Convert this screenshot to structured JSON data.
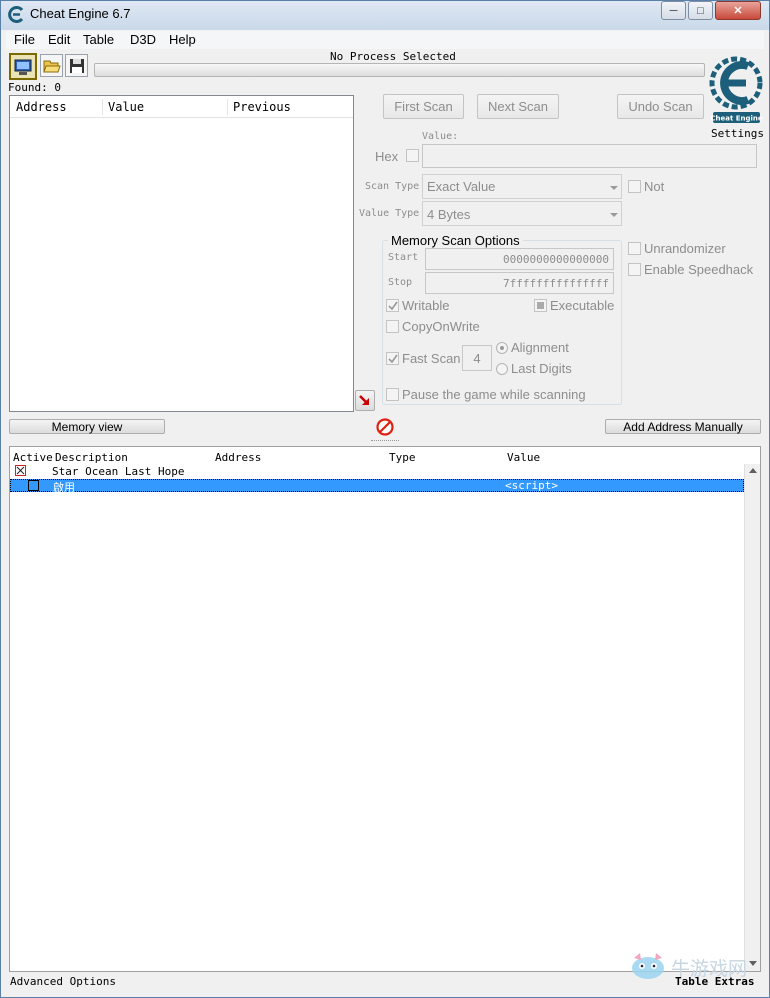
{
  "window": {
    "title": "Cheat Engine 6.7"
  },
  "menu": [
    "File",
    "Edit",
    "Table",
    "D3D",
    "Help"
  ],
  "toolbar": {
    "process_label": "No Process Selected",
    "found_label": "Found: 0"
  },
  "settings_label": "Settings",
  "logo": {
    "text": "Cheat Engine"
  },
  "results": {
    "columns": [
      "Address",
      "Value",
      "Previous"
    ]
  },
  "scan": {
    "first_scan": "First Scan",
    "next_scan": "Next Scan",
    "undo_scan": "Undo Scan",
    "value_label": "Value:",
    "hex_label": "Hex",
    "scan_type_label": "Scan Type",
    "scan_type_value": "Exact Value",
    "not_label": "Not",
    "value_type_label": "Value Type",
    "value_type_value": "4 Bytes",
    "memory_options_title": "Memory Scan Options",
    "start_label": "Start",
    "start_value": "0000000000000000",
    "stop_label": "Stop",
    "stop_value": "7fffffffffffffff",
    "writable": "Writable",
    "executable": "Executable",
    "copy_on_write": "CopyOnWrite",
    "fast_scan": "Fast Scan",
    "fast_scan_value": "4",
    "alignment": "Alignment",
    "last_digits": "Last Digits",
    "pause_game": "Pause the game while scanning",
    "unrandomizer": "Unrandomizer",
    "enable_speedhack": "Enable Speedhack"
  },
  "memory_view_button": "Memory view",
  "add_address_button": "Add Address Manually",
  "table": {
    "columns": [
      "Active",
      "Description",
      "Address",
      "Type",
      "Value"
    ],
    "rows": [
      {
        "description": "Star Ocean Last Hope",
        "address": "",
        "type": "",
        "value": ""
      },
      {
        "description": "啟用",
        "address": "",
        "type": "",
        "value": "<script>"
      }
    ]
  },
  "footer": {
    "advanced_options": "Advanced Options",
    "table_extras": "Table Extras"
  },
  "watermark": {
    "text": "牛游戏网"
  },
  "colors": {
    "selection": "#3399ff",
    "accent": "#1d5f7a"
  }
}
